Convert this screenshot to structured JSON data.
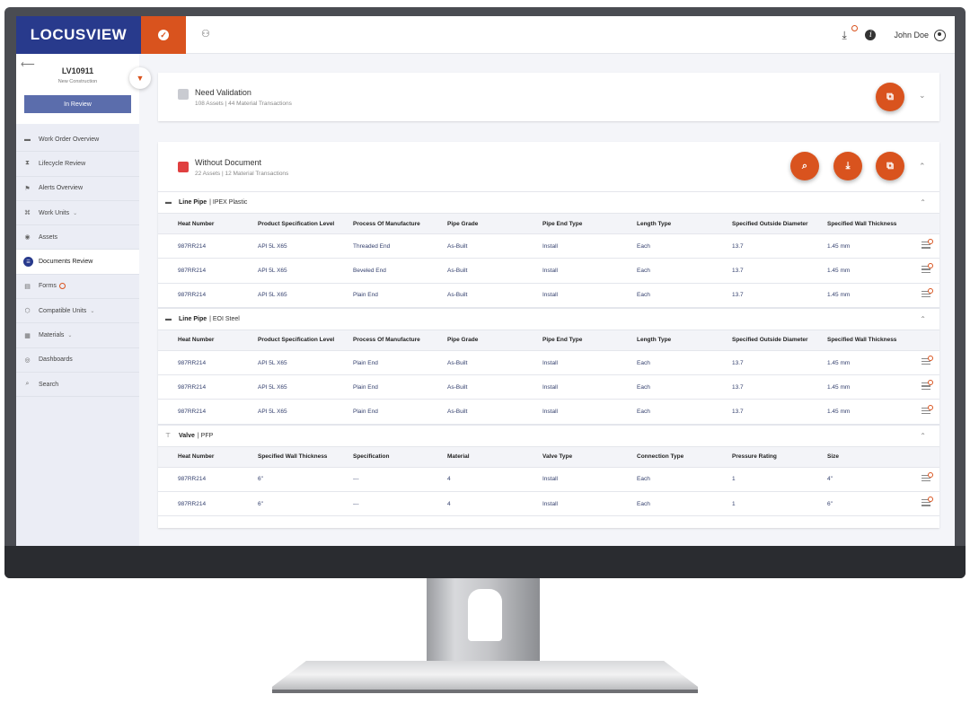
{
  "app": {
    "logo": "LOCUSVIEW",
    "user_name": "John Doe"
  },
  "work_order": {
    "id": "LV10911",
    "type": "New Construction",
    "status_button": "In Review"
  },
  "sidebar": {
    "items": [
      {
        "label": "Work Order Overview",
        "icon": "briefcase-icon"
      },
      {
        "label": "Lifecycle Review",
        "icon": "lifecycle-icon"
      },
      {
        "label": "Alerts Overview",
        "icon": "flag-icon"
      },
      {
        "label": "Work Units",
        "icon": "hierarchy-icon",
        "has_caret": true
      },
      {
        "label": "Assets",
        "icon": "pin-icon"
      },
      {
        "label": "Documents Review",
        "icon": "document-icon",
        "active": true
      },
      {
        "label": "Forms",
        "icon": "form-icon",
        "badge": true
      },
      {
        "label": "Compatible Units",
        "icon": "units-icon",
        "has_caret": true
      },
      {
        "label": "Materials",
        "icon": "materials-icon",
        "has_caret": true
      },
      {
        "label": "Dashboards",
        "icon": "dashboard-icon"
      },
      {
        "label": "Search",
        "icon": "search-icon"
      }
    ]
  },
  "need_validation": {
    "title": "Need Validation",
    "subtitle": "108 Assets | 44 Material Transactions"
  },
  "without_document": {
    "title": "Without Document",
    "subtitle": "22 Assets | 12 Material Transactions"
  },
  "sections": [
    {
      "title": "Line Pipe",
      "subtitle": "| IPEX Plastic",
      "columns": [
        "Heat Number",
        "Product Specification Level",
        "Process Of Manufacture",
        "Pipe Grade",
        "Pipe End Type",
        "Length Type",
        "Specified Outside Diameter",
        "Specified Wall Thickness"
      ],
      "rows": [
        [
          "987RR214",
          "API 5L X65",
          "Threaded End",
          "As-Built",
          "Install",
          "Each",
          "13.7",
          "1.45 mm"
        ],
        [
          "987RR214",
          "API 5L X65",
          "Beveled End",
          "As-Built",
          "Install",
          "Each",
          "13.7",
          "1.45 mm"
        ],
        [
          "987RR214",
          "API 5L X65",
          "Plain End",
          "As-Built",
          "Install",
          "Each",
          "13.7",
          "1.45 mm"
        ]
      ]
    },
    {
      "title": "Line Pipe",
      "subtitle": "| EOI Steel",
      "columns": [
        "Heat Number",
        "Product Specification Level",
        "Process Of Manufacture",
        "Pipe Grade",
        "Pipe End Type",
        "Length Type",
        "Specified Outside Diameter",
        "Specified Wall Thickness"
      ],
      "rows": [
        [
          "987RR214",
          "API 5L X65",
          "Plain End",
          "As-Built",
          "Install",
          "Each",
          "13.7",
          "1.45 mm"
        ],
        [
          "987RR214",
          "API 5L X65",
          "Plain End",
          "As-Built",
          "Install",
          "Each",
          "13.7",
          "1.45 mm"
        ],
        [
          "987RR214",
          "API 5L X65",
          "Plain End",
          "As-Built",
          "Install",
          "Each",
          "13.7",
          "1.45 mm"
        ]
      ]
    },
    {
      "title": "Valve",
      "subtitle": "|  PFP",
      "columns": [
        "Heat Number",
        "Specified Wall Thickness",
        "Specification",
        "Material",
        "Valve Type",
        "Connection Type",
        "Pressure Rating",
        "Size"
      ],
      "rows": [
        [
          "987RR214",
          "6\"",
          "---",
          "4",
          "Install",
          "Each",
          "1",
          "4\""
        ],
        [
          "987RR214",
          "6\"",
          "---",
          "4",
          "Install",
          "Each",
          "1",
          "6\""
        ]
      ]
    }
  ],
  "colors": {
    "brand_navy": "#283a8c",
    "accent_orange": "#d9531e",
    "sidebar_bg": "#ebedf5"
  }
}
